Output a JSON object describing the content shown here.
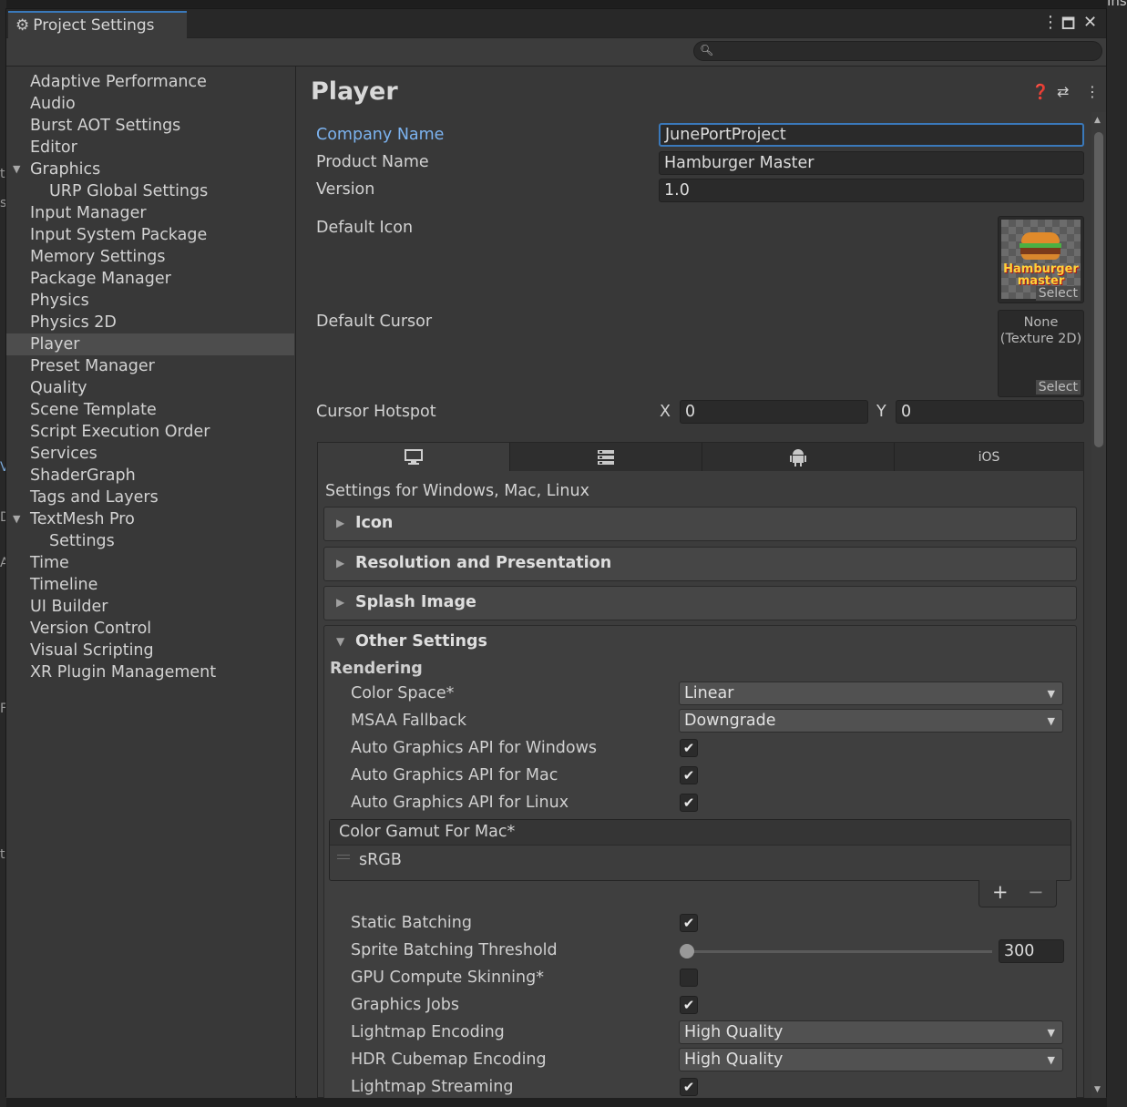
{
  "window": {
    "title": "Project Settings",
    "bg_right_label": "Inspecto"
  },
  "search": {
    "placeholder": ""
  },
  "sidebar": {
    "items": [
      {
        "label": "Adaptive Performance"
      },
      {
        "label": "Audio"
      },
      {
        "label": "Burst AOT Settings"
      },
      {
        "label": "Editor"
      },
      {
        "label": "Graphics"
      },
      {
        "label": "URP Global Settings"
      },
      {
        "label": "Input Manager"
      },
      {
        "label": "Input System Package"
      },
      {
        "label": "Memory Settings"
      },
      {
        "label": "Package Manager"
      },
      {
        "label": "Physics"
      },
      {
        "label": "Physics 2D"
      },
      {
        "label": "Player"
      },
      {
        "label": "Preset Manager"
      },
      {
        "label": "Quality"
      },
      {
        "label": "Scene Template"
      },
      {
        "label": "Script Execution Order"
      },
      {
        "label": "Services"
      },
      {
        "label": "ShaderGraph"
      },
      {
        "label": "Tags and Layers"
      },
      {
        "label": "TextMesh Pro"
      },
      {
        "label": "Settings"
      },
      {
        "label": "Time"
      },
      {
        "label": "Timeline"
      },
      {
        "label": "UI Builder"
      },
      {
        "label": "Version Control"
      },
      {
        "label": "Visual Scripting"
      },
      {
        "label": "XR Plugin Management"
      }
    ],
    "selected": "Player"
  },
  "player": {
    "title": "Player",
    "company_name_label": "Company Name",
    "company_name": "JunePortProject",
    "product_name_label": "Product Name",
    "product_name": "Hamburger Master",
    "version_label": "Version",
    "version": "1.0",
    "default_icon_label": "Default Icon",
    "icon_text_line1": "Hamburger",
    "icon_text_line2": "master",
    "select_label": "Select",
    "default_cursor_label": "Default Cursor",
    "cursor_none_line1": "None",
    "cursor_none_line2": "(Texture 2D)",
    "cursor_hotspot_label": "Cursor Hotspot",
    "hotspot_x_label": "X",
    "hotspot_x": "0",
    "hotspot_y_label": "Y",
    "hotspot_y": "0"
  },
  "platform": {
    "tabs": [
      {
        "icon": "desktop-icon",
        "label": ""
      },
      {
        "icon": "server-icon",
        "label": ""
      },
      {
        "icon": "android-icon",
        "label": ""
      },
      {
        "icon": "",
        "label": "iOS"
      }
    ],
    "caption": "Settings for Windows, Mac, Linux",
    "foldouts": [
      "Icon",
      "Resolution and Presentation",
      "Splash Image"
    ],
    "other_settings": "Other Settings",
    "rendering": "Rendering",
    "rows": {
      "color_space": {
        "label": "Color Space*",
        "value": "Linear"
      },
      "msaa": {
        "label": "MSAA Fallback",
        "value": "Downgrade"
      },
      "agapi_win": {
        "label": "Auto Graphics API  for Windows",
        "checked": true
      },
      "agapi_mac": {
        "label": "Auto Graphics API  for Mac",
        "checked": true
      },
      "agapi_linux": {
        "label": "Auto Graphics API  for Linux",
        "checked": true
      },
      "static_batching": {
        "label": "Static Batching",
        "checked": true
      },
      "sprite_threshold": {
        "label": "Sprite Batching Threshold",
        "value": "300"
      },
      "gpu_skinning": {
        "label": "GPU Compute Skinning*",
        "checked": false
      },
      "graphics_jobs": {
        "label": "Graphics Jobs",
        "checked": true
      },
      "lightmap_encoding": {
        "label": "Lightmap Encoding",
        "value": "High Quality"
      },
      "hdr_cubemap": {
        "label": "HDR Cubemap Encoding",
        "value": "High Quality"
      },
      "lightmap_streaming": {
        "label": "Lightmap Streaming",
        "checked": true
      }
    },
    "color_gamut": {
      "title": "Color Gamut For Mac*",
      "items": [
        "sRGB"
      ]
    }
  },
  "colors": {
    "accent": "#3a79bb",
    "label_highlight": "#7cb3f0",
    "bg": "#383838"
  }
}
